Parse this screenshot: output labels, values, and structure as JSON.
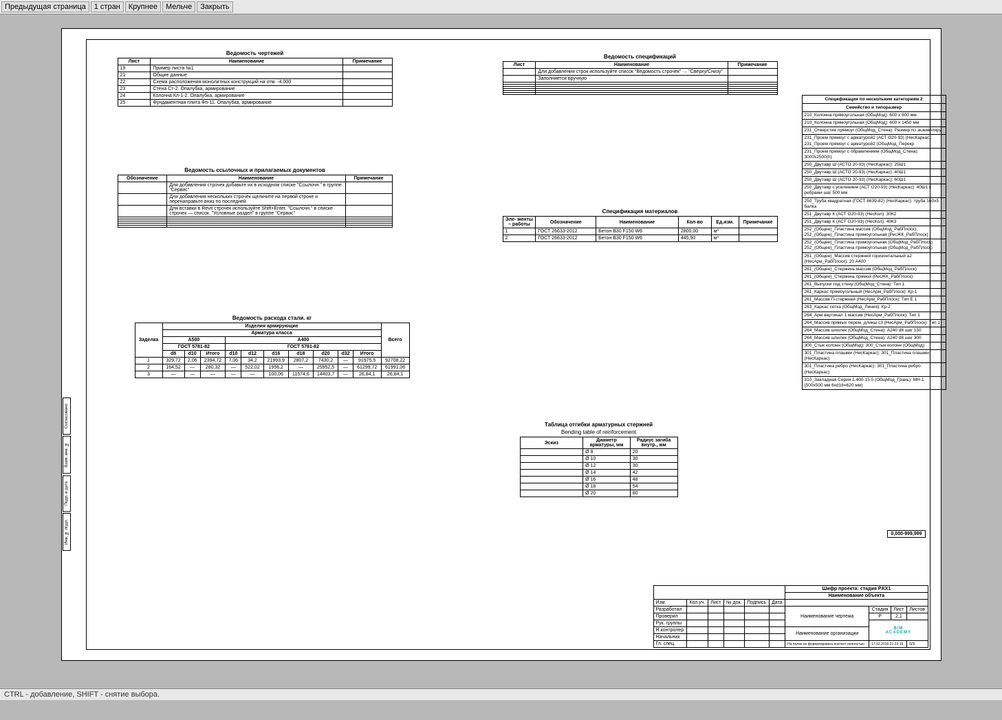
{
  "toolbar": {
    "prev": "Предыдущая страница",
    "page": "1 стран",
    "zoomin": "Крупнее",
    "zoomout": "Мельче",
    "close": "Закрыть"
  },
  "statusbar": "CTRL - добавление, SHIFT - снятие выбора.",
  "side_tabs": [
    "Согласовано",
    "Взам. инв. №",
    "Подп. и дата",
    "Инв. № подл."
  ],
  "drawings": {
    "title": "Ведомость чертежей",
    "cols": [
      "Лист",
      "Наименование",
      "Примечание"
    ],
    "rows": [
      [
        "19",
        "Пример листа №1",
        ""
      ],
      [
        "21",
        "Общие данные",
        ""
      ],
      [
        "22",
        "Схема расположения монолитных конструкций на отм. -4.000",
        ""
      ],
      [
        "23",
        "Стена Ст-2. Опалубка, армирование",
        ""
      ],
      [
        "24",
        "Колонна Кл-1-2. Опалубка, армирование",
        ""
      ],
      [
        "25",
        "Фундаментная плита Фп-11. Опалубка, армирование",
        ""
      ]
    ]
  },
  "refs": {
    "title": "Ведомость ссылочных и прилагаемых документов",
    "cols": [
      "Обозначение",
      "Наименование",
      "Примечание"
    ],
    "rows": [
      [
        "",
        "Для добавления строчек добавьте их в исходном списке \"Ссылочн.\" в группе \"Сервис\"",
        ""
      ],
      [
        "",
        "Для добавления нескольких строчек щелкните на первой строке и перенаправьте вниз по последней",
        ""
      ],
      [
        "",
        "Для вставки в Revit строчек используйте Shift+Enter. \"Ссылочн.\" в списке строчек — список. \"Условные раздел\" в группе \"Сервис\"",
        ""
      ],
      [
        "",
        "",
        ""
      ],
      [
        "",
        "",
        ""
      ],
      [
        "",
        "",
        ""
      ],
      [
        "",
        "",
        ""
      ],
      [
        "",
        "",
        ""
      ]
    ]
  },
  "steel": {
    "title": "Ведомость расхода стали. кг",
    "group_top": "Изделия армирующие",
    "group_sub": "Арматура класса",
    "class_a": "А500",
    "class_b": "А400",
    "gost_a": "ГОСТ 5781-82",
    "gost_b": "ГОСТ 5781-82",
    "col_spec": "Заделка",
    "col_total": "Всего",
    "dia_a": [
      "d8",
      "d10",
      "Итого"
    ],
    "dia_b": [
      "d10",
      "d12",
      "d16",
      "d18",
      "d20",
      "d32",
      "Итого"
    ],
    "rows": [
      {
        "spec": "1",
        "a": [
          "329,72",
          "2,06",
          "2394,72"
        ],
        "b": [
          "7,06",
          "34,2",
          "21993,9",
          "2807,2",
          "7430,2",
          "—",
          "91975,5"
        ],
        "total": "92708,22"
      },
      {
        "spec": "2",
        "a": [
          "164,52",
          "—",
          "280,32"
        ],
        "b": [
          "—",
          "522,02",
          "1956,2",
          "—",
          "25952,5",
          "—",
          "61299,72"
        ],
        "total": "61991,06"
      },
      {
        "spec": "3",
        "a": [
          "—",
          "—",
          "—"
        ],
        "b": [
          "—",
          "—",
          "100,06",
          "11574,6",
          "14403,7",
          "—",
          "26,84,1"
        ],
        "total": "26,84,1"
      }
    ]
  },
  "speclist": {
    "title": "Ведомость спецификаций",
    "cols": [
      "Лист",
      "Наименование",
      "Примечание"
    ],
    "rows": [
      [
        "",
        "Для добавления строк используйте список \"Ведомость строчек\" → \"Сверху/Снизу\"",
        ""
      ],
      [
        "",
        "Заполняется вручную",
        ""
      ],
      [
        "",
        "",
        ""
      ],
      [
        "",
        "",
        ""
      ],
      [
        "",
        "",
        ""
      ],
      [
        "",
        "",
        ""
      ],
      [
        "",
        "",
        ""
      ],
      [
        "",
        "",
        ""
      ]
    ]
  },
  "materials": {
    "title": "Спецификация материалов",
    "cols": [
      "Эле-\nменты –\nработы",
      "Обозначение",
      "Наименование",
      "Кол-во",
      "Ед.изм.",
      "Примечание"
    ],
    "rows": [
      [
        "1",
        "ГОСТ 26633-2012",
        "Бетон В30 F150 W6",
        "2800,00",
        "м³",
        ""
      ],
      [
        "2",
        "ГОСТ 26633-2012",
        "Бетон В30 F150 W6",
        "445,90",
        "м³",
        ""
      ]
    ]
  },
  "bending": {
    "title_ru": "Таблица отгибки арматурных стержней",
    "title_en": "Bending table of reinforcement",
    "cols": [
      "Эскиз",
      "Диаметр\nарматуры, мм",
      "Радиус загиба\nвнутр., мм"
    ],
    "rows": [
      [
        "",
        "Ø 8",
        "20"
      ],
      [
        "",
        "Ø 10",
        "30"
      ],
      [
        "",
        "Ø 12",
        "30"
      ],
      [
        "",
        "Ø 14",
        "42"
      ],
      [
        "",
        "Ø 16",
        "48"
      ],
      [
        "",
        "Ø 18",
        "54"
      ],
      [
        "",
        "Ø 20",
        "80"
      ]
    ]
  },
  "catspec": {
    "title": "Спецификация по нескольким категориям 2",
    "sub": "Семейство и типоразмер",
    "rows": [
      "210_Колонна прямоугольная (ОбщМод): 600 х 600 мм",
      "210_Колонна прямоугольная (ОбщМод): 600 х 1450 мм",
      "231_Отверстие прямоуг (ОбщМод_Стена): Размер по экземпляру",
      "231_Проем прямоуг с арматурой2 (АСТ О20-93) (НесКаркас): 231_Проем прямоуг с арматурой2 (ОбщМод_Перекр",
      "231_Проем прямоуг с обрамлением (ОбщМод_Стена): 3000х2500(h)",
      "250_Двутавр Ш (АСТО 20-93) (НесКаркас): 25Ш1",
      "250_Двутавр Ш (АСТО 20-93) (НесКаркас): 40Ш1",
      "250_Двутавр Ш (АСТО 20-93) (НесКаркас): 60Ш1",
      "250_Двутавр с усилением (АСТ О20-93) (НесКаркас): 40Ш1 с ребрами шаг 500 мм",
      "250_Труба квадратная (ГОСТ 8639-82) (НесКаркас): труба 160х5 балка",
      "251_Двутавр К (АСТ О20-93) (НесКол): 30К2",
      "251_Двутавр К (АСТ О20-93) (НесКол): 40К3",
      "252_(Общее)_Пластина массив (ОбщМод_РабПлоск): 252_(Общее)_Пластина прямоугольная (РесЖК_РабПлоск)",
      "252_(Общее)_Пластина прямоугольная (ОбщМод_РабПлоск): 252_(Общее)_Пластина прямоугольная (ОбщМод_РабПлоск)",
      "261_(Общее)_Массив стержней горизонтальный a2 (НесАрм_РабПлоск): 20 А400",
      "261_(Общее)_Стержень массив (ОбщМод_РабПлоск):",
      "261_(Общее)_Стержень прямой (РесЖК_РабПлоск):",
      "261_Выпуски под стену (ОбщМод_Стена): Тип 1",
      "261_Каркас прямоугольный (НесАрм_РабПлоск): Кр-1",
      "261_Массив П-стержней (НесАрм_РабПлоск): Тип Е 1",
      "263_Каркас сетка (ОбщМод_Линия): Кр-2",
      "264_Арм вертикал 1 массив (НесАрм_РабПлоск): Тип 1",
      "264_Массив прямых перем. длины с3 (НесАрм_РабПлоск): Тип 1",
      "264_Массив шпилек (ОбщМод_Стена): А240 d8 шаг 150",
      "264_Массив шпилек (ОбщМод_Стена): А240 d8 шаг 300",
      "300_Стык колонн (ОбщМод): 300_Стык колонн (ОбщМод)",
      "301_Пластина плашми (НесКаркас): 301_Пластина плашми (НесКаркас)",
      "301_Пластина ребро (НесКаркас): 301_Пластина ребро (НесКаркас)",
      "310_Закладная Серия 1.400-15.0 (ОбщМод_Грань): МН-1 (500х500 мм 6хd16=620 мм)"
    ]
  },
  "sheet_label": "0,000-999,999",
  "stamp": {
    "cipher": "Шифр проекта: стадия Р.КХ1",
    "project": "Наименование объекта",
    "drawing": "Наименование чертежа",
    "org": "Наименование организации",
    "stage_h": "Стадия",
    "sheet_h": "Лист",
    "sheets_h": "Листов",
    "stage": "Р",
    "sheet": "2,1",
    "sheets": "",
    "role_cols": [
      "Изм.",
      "Кол.уч.",
      "Лист",
      "№ док.",
      "Подпись",
      "Дата"
    ],
    "roles": [
      "Разработал",
      "Проверил",
      "Рук. группы",
      "Н.контролер",
      "Начальник",
      "Гл. спец."
    ],
    "note": "На полях не форматировать контент полностью",
    "note2": "17.02.2016 21:23:19",
    "note3": "0Z5",
    "logo": "BIM",
    "logo_sub": "ACADEMY"
  }
}
